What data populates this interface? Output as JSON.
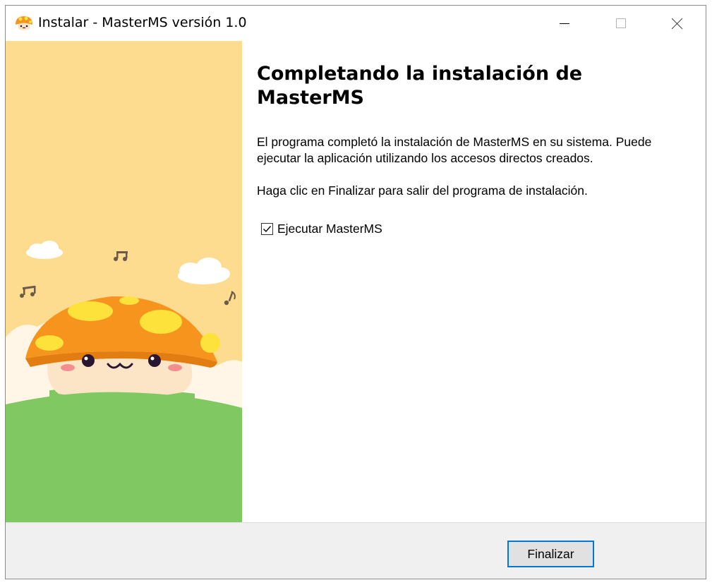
{
  "window": {
    "title": "Instalar - MasterMS versión 1.0"
  },
  "icons": {
    "app": "mushroom-icon",
    "minimize": "minimize-icon",
    "maximize": "maximize-icon",
    "close": "close-icon",
    "check": "checkmark-icon"
  },
  "main": {
    "heading": "Completando la instalación de MasterMS",
    "paragraph1": "El programa completó la instalación de MasterMS en su sistema. Puede ejecutar la aplicación utilizando los accesos directos creados.",
    "paragraph2": "Haga clic en Finalizar para salir del programa de instalación.",
    "run_checkbox": {
      "label": "Ejecutar MasterMS",
      "checked": true
    }
  },
  "footer": {
    "finish_label": "Finalizar"
  },
  "colors": {
    "accent": "#0078d7",
    "sky": "#fddb8f",
    "grass": "#7fc862",
    "mushroom_cap": "#f7941d",
    "mushroom_spots": "#fde23c"
  }
}
